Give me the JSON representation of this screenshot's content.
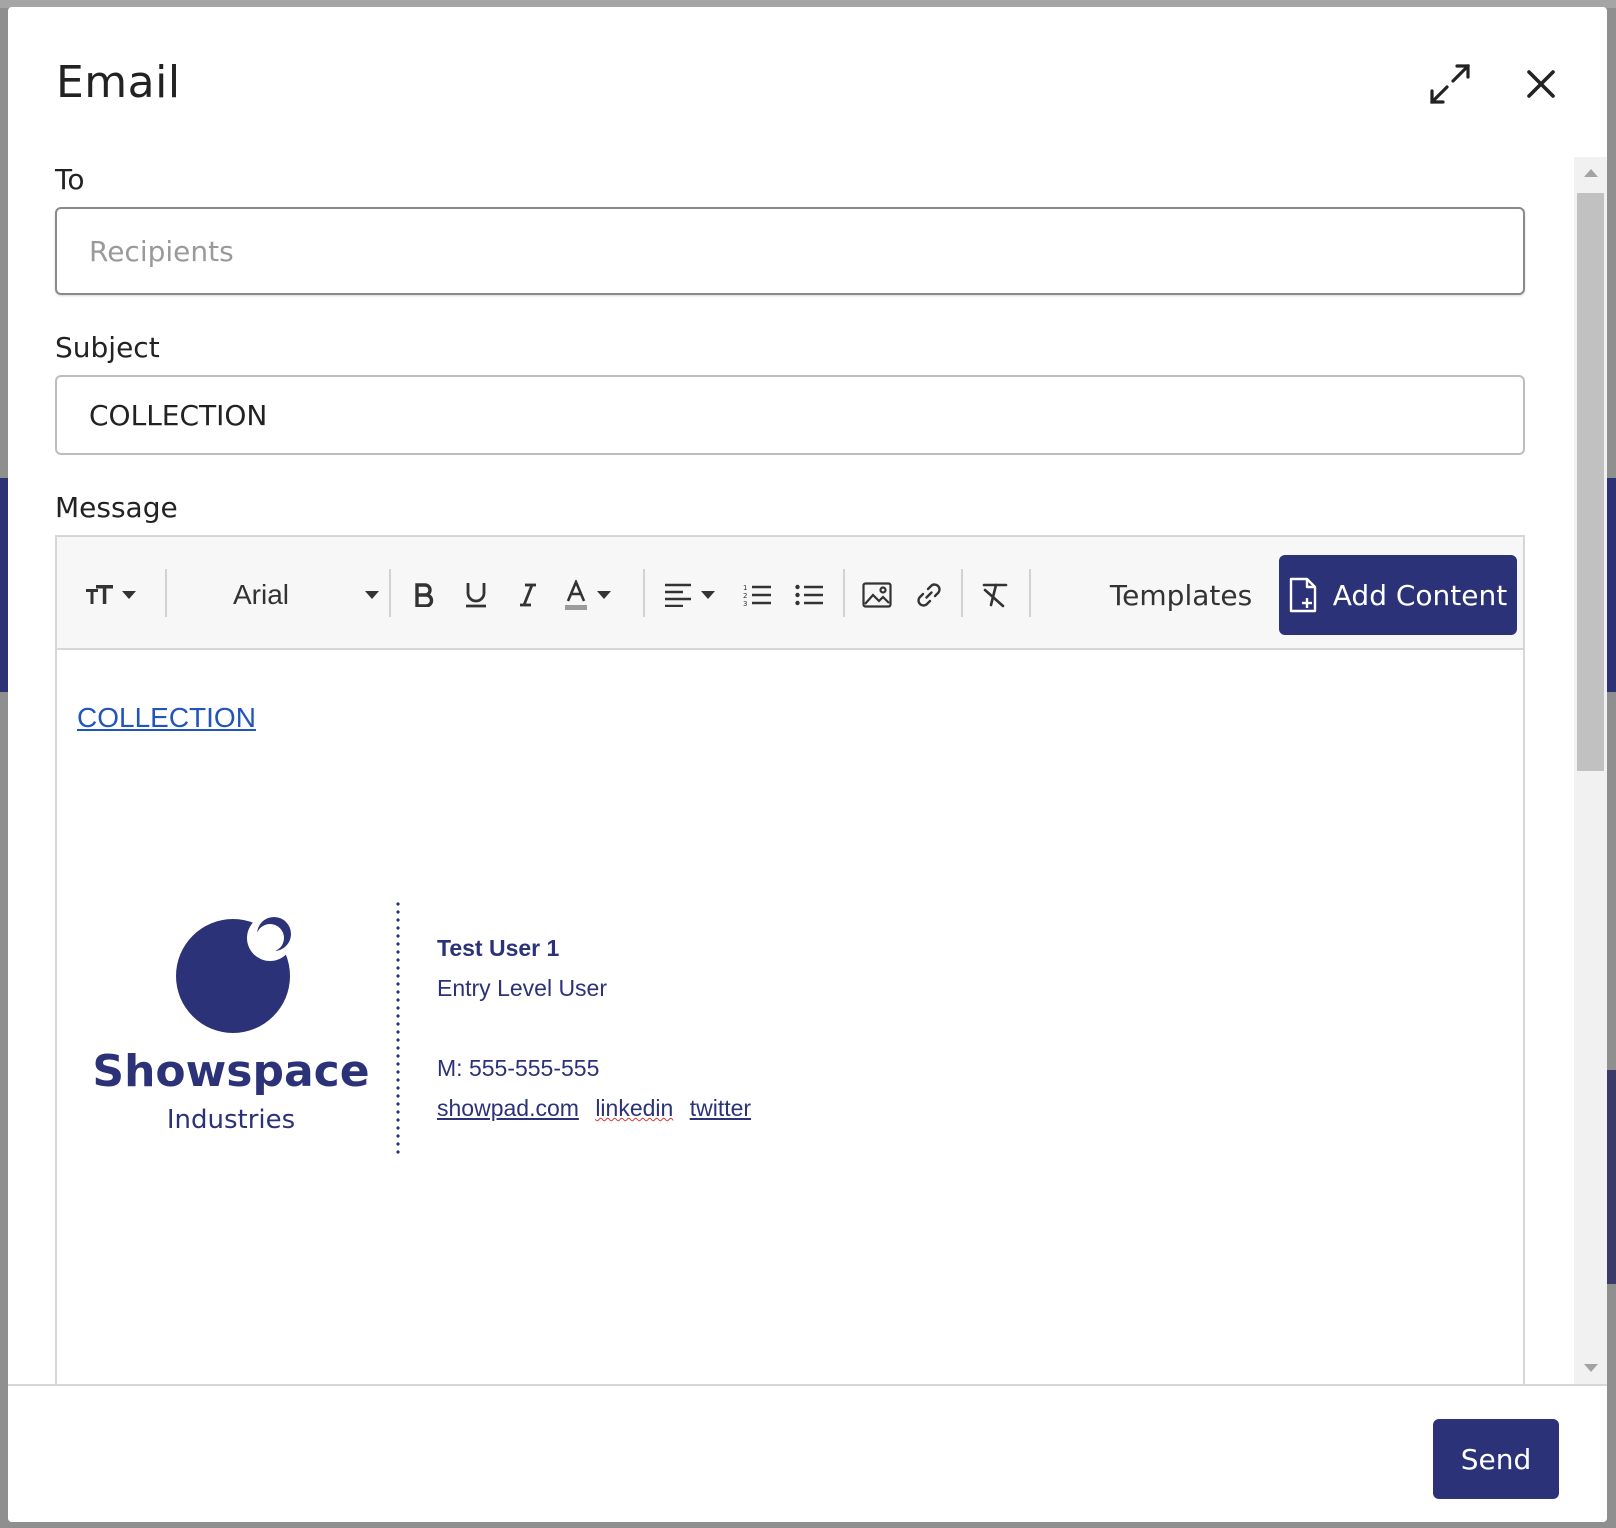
{
  "modal": {
    "title": "Email"
  },
  "to": {
    "label": "To",
    "placeholder": "Recipients",
    "value": ""
  },
  "subject": {
    "label": "Subject",
    "value": "COLLECTION"
  },
  "message": {
    "label": "Message",
    "toolbar": {
      "font_name": "Arial",
      "templates_label": "Templates",
      "add_content_label": "Add Content"
    },
    "body_link": "COLLECTION",
    "signature": {
      "company": "Showspace",
      "company_sub": "Industries",
      "name": "Test User 1",
      "role": "Entry Level User",
      "phone": "M: 555-555-555",
      "links": [
        "showpad.com",
        "linkedin",
        "twitter"
      ]
    }
  },
  "footer": {
    "send_label": "Send"
  },
  "colors": {
    "brand": "#2c3278",
    "link": "#2255bb"
  },
  "icons": [
    "expand-icon",
    "close-icon",
    "text-size-icon",
    "bold-icon",
    "underline-icon",
    "italic-icon",
    "font-color-icon",
    "align-left-icon",
    "ordered-list-icon",
    "bullet-list-icon",
    "image-icon",
    "link-icon",
    "clear-format-icon",
    "add-file-icon"
  ]
}
